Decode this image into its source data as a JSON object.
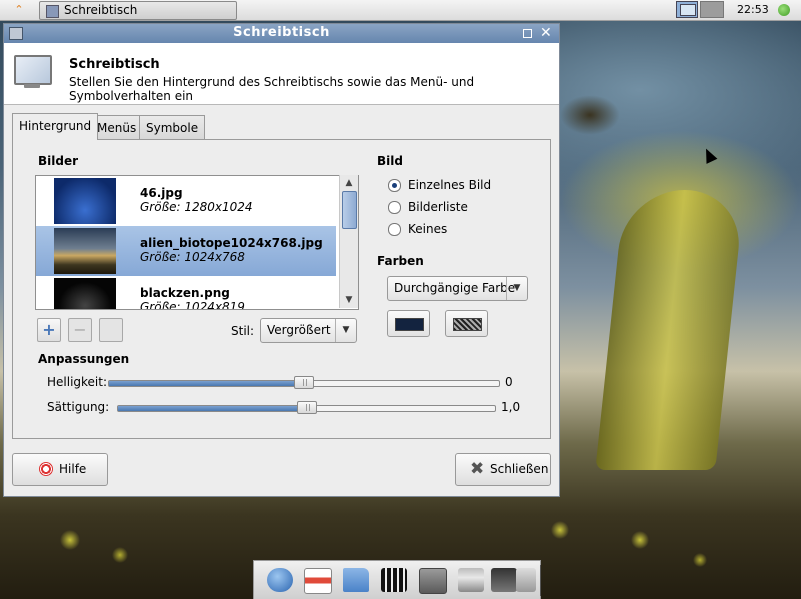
{
  "top_panel": {
    "taskbar_window_label": "Schreibtisch",
    "clock": "22:53",
    "colors": {
      "workspace_active": "#8fb0d8",
      "workspace_inactive": "#9c9c9c"
    }
  },
  "window": {
    "title": "Schreibtisch",
    "header_title": "Schreibtisch",
    "header_description": "Stellen Sie den Hintergrund des Schreibtischs sowie das Menü- und Symbolverhalten ein",
    "tabs": [
      {
        "label": "Hintergrund",
        "active": true
      },
      {
        "label": "Menüs",
        "active": false
      },
      {
        "label": "Symbole",
        "active": false
      }
    ],
    "images_section_title": "Bilder",
    "images": [
      {
        "name": "46.jpg",
        "size": "Größe: 1280x1024",
        "selected": false
      },
      {
        "name": "alien_biotope1024x768.jpg",
        "size": "Größe: 1024x768",
        "selected": true
      },
      {
        "name": "blackzen.png",
        "size": "Größe: 1024x819",
        "selected": false
      }
    ],
    "add_symbol": "+",
    "remove_symbol": "−",
    "style_label": "Stil:",
    "style_value": "Vergrößert",
    "image_section_title": "Bild",
    "image_options": [
      {
        "label": "Einzelnes Bild",
        "checked": true
      },
      {
        "label": "Bilderliste",
        "checked": false
      },
      {
        "label": "Keines",
        "checked": false
      }
    ],
    "colors_section_title": "Farben",
    "color_mode_value": "Durchgängige Farbe",
    "primary_color": "#13233f",
    "adjustments_title": "Anpassungen",
    "brightness": {
      "label": "Helligkeit:",
      "value": "0",
      "level": 0.5
    },
    "saturation": {
      "label": "Sättigung:",
      "value": "1,0",
      "level": 0.5
    },
    "help_button_label": "Hilfe",
    "close_button_label": "Schließen"
  },
  "dock": {
    "items": [
      "globe-icon",
      "calendar-icon",
      "folder-icon",
      "clapperboard-icon",
      "terminal-icon",
      "printer-icon",
      "network-icon",
      "drive-icon"
    ]
  }
}
